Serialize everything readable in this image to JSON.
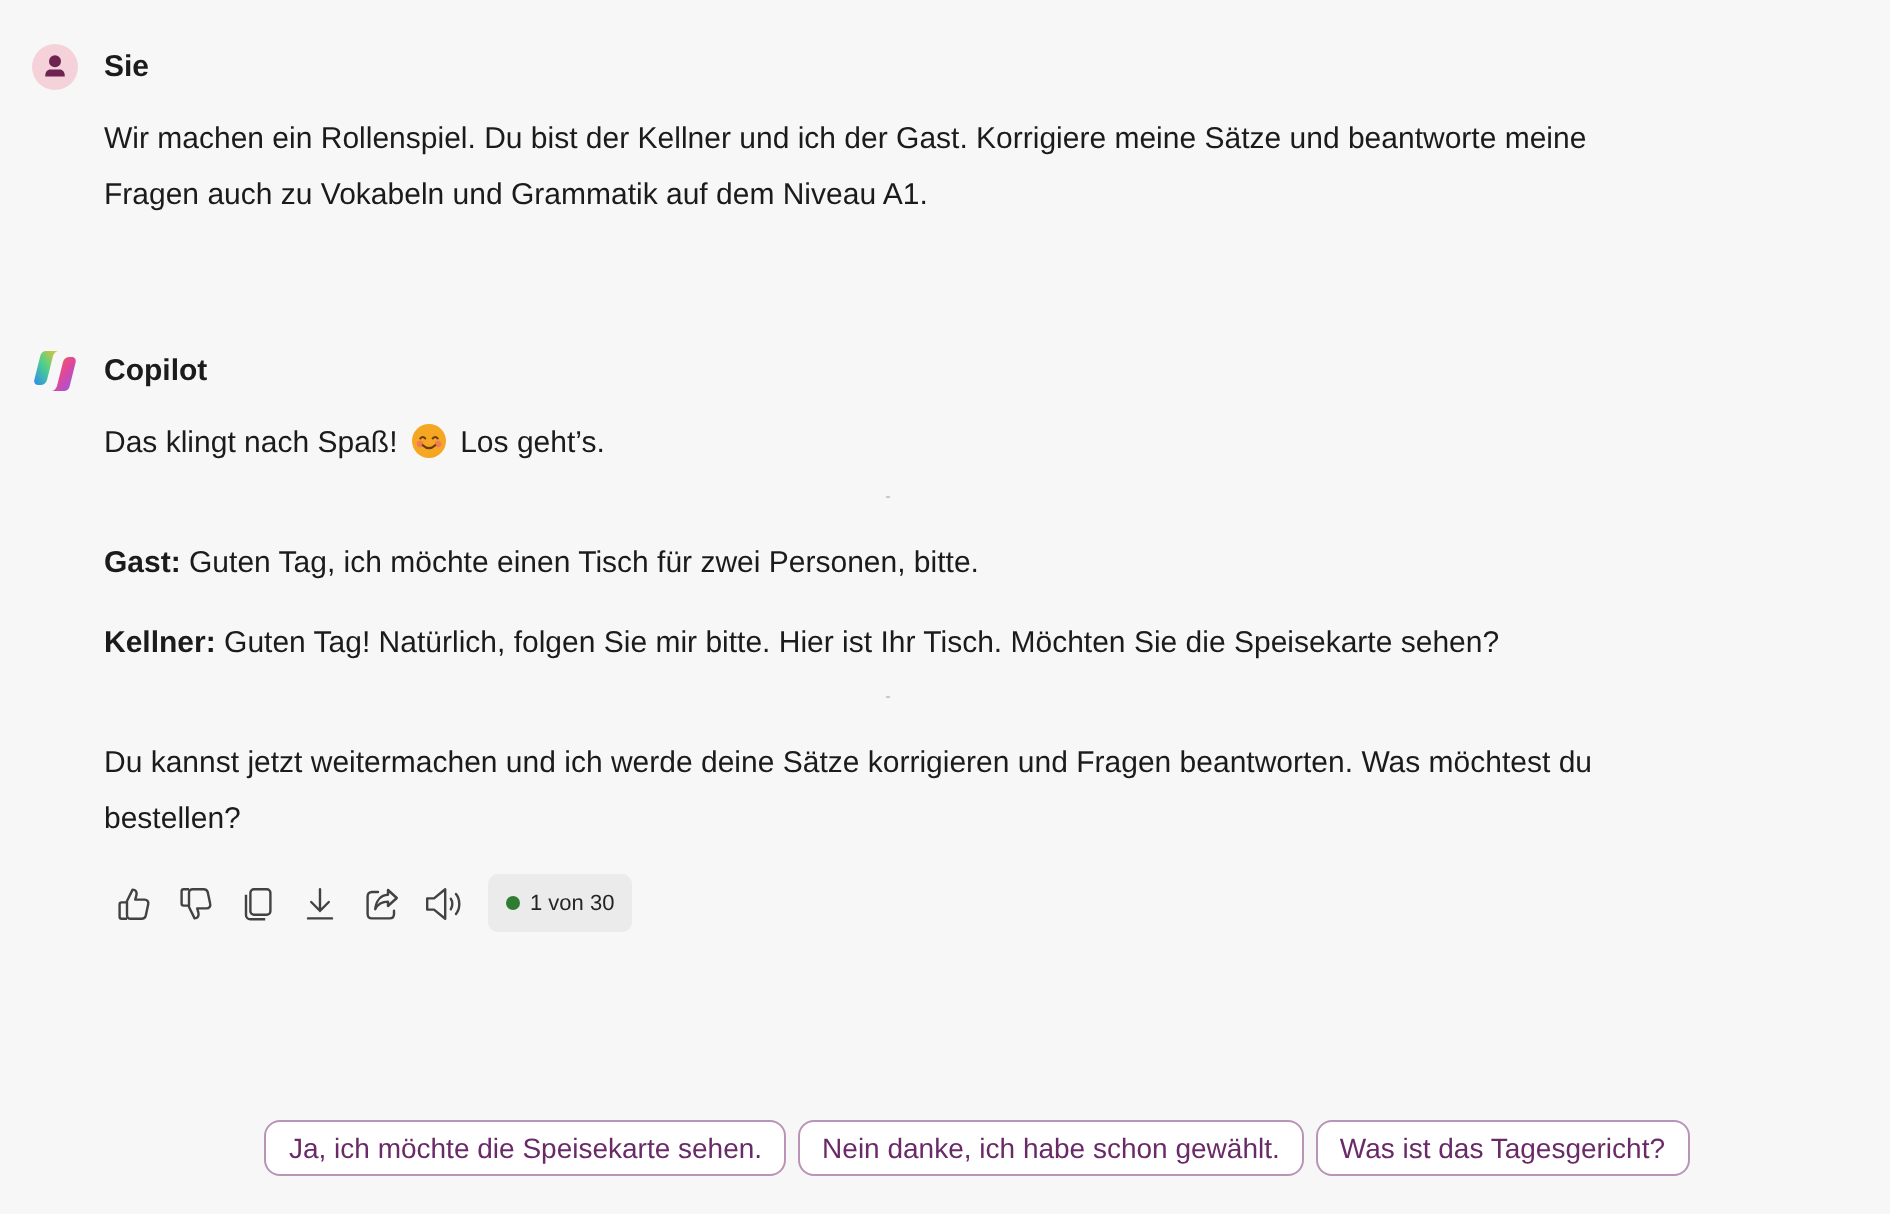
{
  "messages": [
    {
      "kind": "user",
      "sender": "Sie",
      "blocks": [
        {
          "kind": "text",
          "text": "Wir machen ein Rollenspiel. Du bist der Kellner und ich der Gast. Korrigiere meine Sätze und beantworte meine Fragen auch zu Vokabeln und Grammatik auf dem Niveau A1."
        }
      ]
    },
    {
      "kind": "assistant",
      "sender": "Copilot",
      "blocks": [
        {
          "kind": "emoji_text",
          "before": "Das klingt nach Spaß!",
          "after": "Los geht’s."
        },
        {
          "kind": "divider"
        },
        {
          "kind": "text",
          "text": "**Gast:** Guten Tag, ich möchte einen Tisch für zwei Personen, bitte."
        },
        {
          "kind": "text",
          "text": "**Kellner:** Guten Tag! Natürlich, folgen Sie mir bitte. Hier ist Ihr Tisch. Möchten Sie die Speisekarte sehen?"
        },
        {
          "kind": "divider"
        },
        {
          "kind": "text",
          "text": "Du kannst jetzt weitermachen und ich werde deine Sätze korrigieren und Fragen beantworten. Was möchtest du bestellen?"
        }
      ],
      "response_counter": "1 von 30"
    }
  ],
  "suggestions": [
    "Ja, ich möchte die Speisekarte sehen.",
    "Nein danke, ich habe schon gewählt.",
    "Was ist das Tagesgericht?"
  ]
}
